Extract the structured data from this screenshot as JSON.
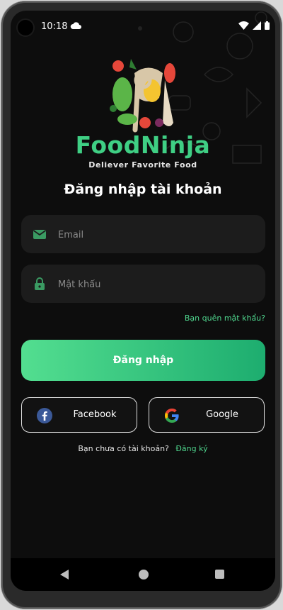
{
  "status_bar": {
    "time": "10:18"
  },
  "brand": {
    "name": "FoodNinja",
    "tagline": "Deliever Favorite Food"
  },
  "login": {
    "heading": "Đăng nhập tài khoản",
    "email_placeholder": "Email",
    "password_placeholder": "Mật khẩu",
    "forgot_password": "Bạn quên mật khẩu?",
    "submit_label": "Đăng nhập"
  },
  "social": {
    "facebook_label": "Facebook",
    "google_label": "Google"
  },
  "signup": {
    "prompt": "Bạn chưa có tài khoản?",
    "link": "Đăng ký"
  },
  "colors": {
    "accent": "#3fcf84",
    "background": "#0d0d0d",
    "field": "#1c1c1c"
  }
}
